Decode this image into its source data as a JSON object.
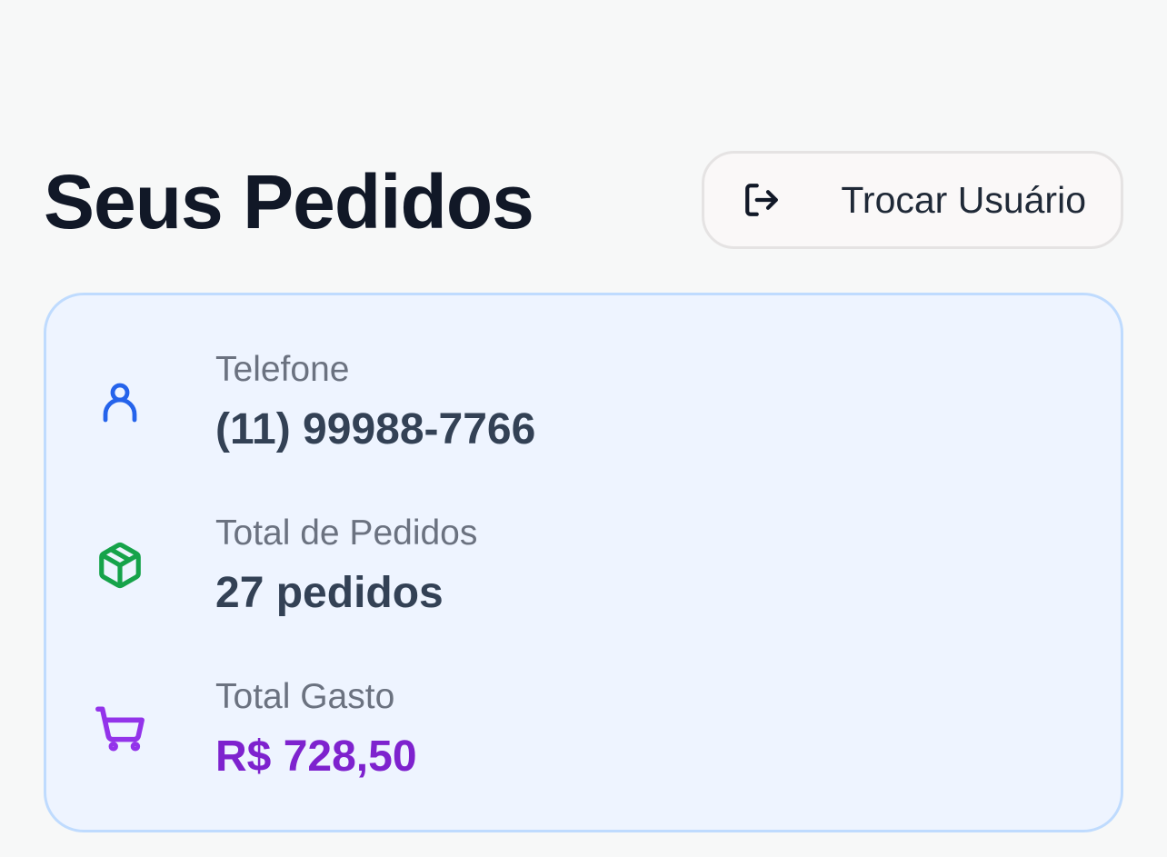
{
  "header": {
    "title": "Seus Pedidos",
    "switch_user_label": "Trocar Usuário",
    "switch_user_icon": "log-out-icon"
  },
  "summary": {
    "items": [
      {
        "label": "Telefone",
        "value": "(11) 99988-7766",
        "icon": "user-icon",
        "icon_color": "#2563eb"
      },
      {
        "label": "Total de Pedidos",
        "value": "27 pedidos",
        "icon": "package-icon",
        "icon_color": "#16a34a"
      },
      {
        "label": "Total Gasto",
        "value": "R$ 728,50",
        "icon": "shopping-cart-icon",
        "icon_color": "#9333ea",
        "value_color": "#7e22ce"
      }
    ]
  },
  "colors": {
    "page_background": "#f7f8f8",
    "card_background": "#eef4ff",
    "card_border": "#bfdbfe",
    "title": "#111827",
    "label": "#6b7280",
    "value": "#334155"
  }
}
